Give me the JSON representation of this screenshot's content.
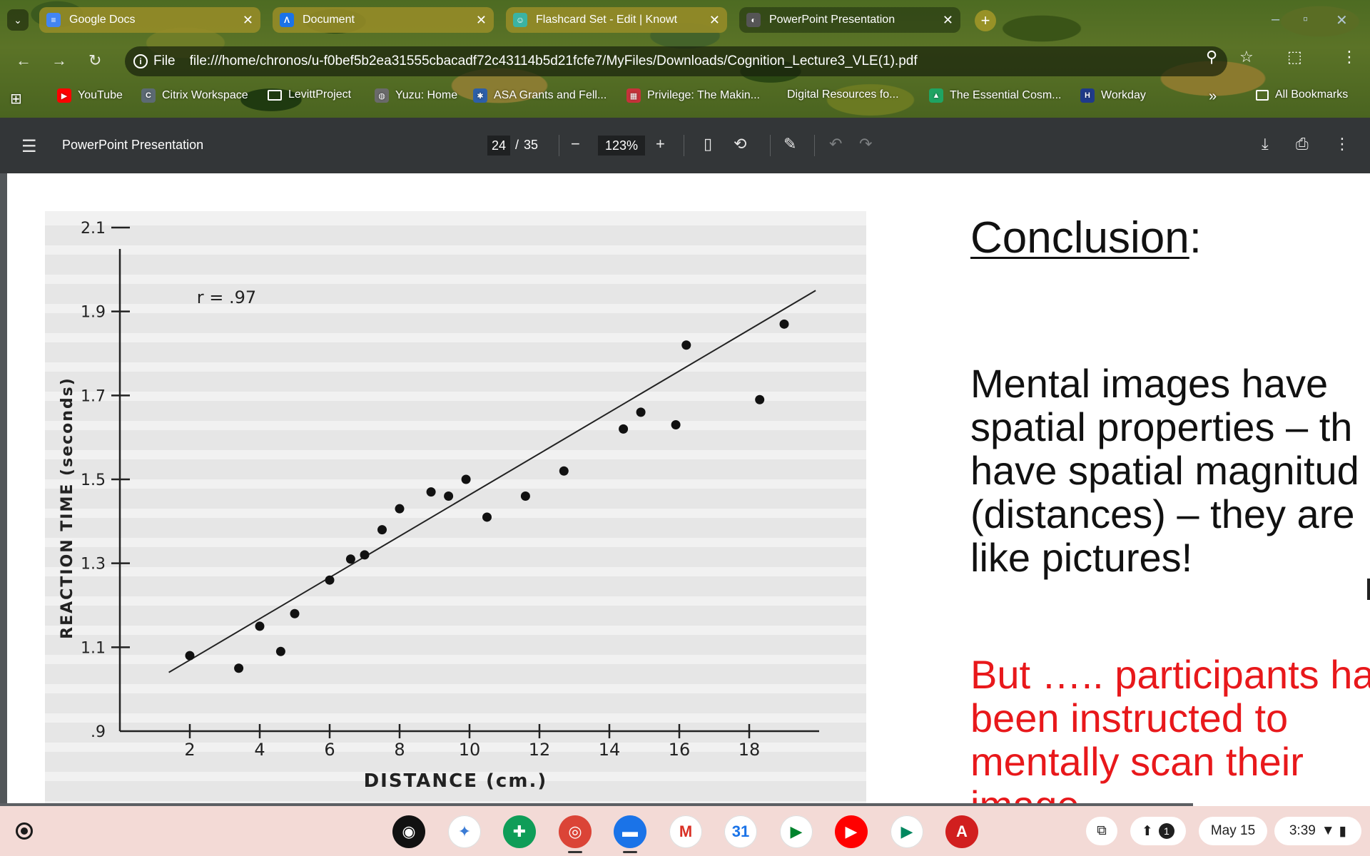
{
  "tabs": [
    {
      "title": "Google Docs",
      "icon": "docs-icon",
      "glyph": "≡",
      "color": "#4285f4",
      "active": false
    },
    {
      "title": "Document",
      "icon": "document-icon",
      "glyph": "Λ",
      "color": "#1a73e8",
      "active": false
    },
    {
      "title": "Flashcard Set - Edit | Knowt",
      "icon": "knowt-icon",
      "glyph": "☺",
      "color": "#3bb3a3",
      "active": false
    },
    {
      "title": "PowerPoint Presentation",
      "icon": "pdf-tab-icon",
      "glyph": "◐",
      "color": "#555555",
      "active": true
    }
  ],
  "omnibox": {
    "scheme": "File",
    "url": "file:///home/chronos/u-f0bef5b2ea31555cbacadf72c43114b5d21fcfe7/MyFiles/Downloads/Cognition_Lecture3_VLE(1).pdf"
  },
  "bookmarks": [
    {
      "label": "YouTube",
      "icon": "youtube-icon",
      "glyph": "▶",
      "color": "#ff0000"
    },
    {
      "label": "Citrix Workspace",
      "icon": "citrix-icon",
      "glyph": "C",
      "color": "#5c6a73"
    },
    {
      "label": "LevittProject",
      "icon": "folder-icon",
      "glyph": "",
      "color": "transparent"
    },
    {
      "label": "Yuzu: Home",
      "icon": "globe-icon",
      "glyph": "◍",
      "color": "#6a6a6a"
    },
    {
      "label": "ASA Grants and Fell...",
      "icon": "asa-icon",
      "glyph": "✱",
      "color": "#2d5fa8"
    },
    {
      "label": "Privilege: The Makin...",
      "icon": "book-icon",
      "glyph": "▦",
      "color": "#c7323a"
    },
    {
      "label": "Digital Resources fo...",
      "icon": "",
      "glyph": "",
      "color": "transparent"
    },
    {
      "label": "The Essential Cosm...",
      "icon": "drive-icon",
      "glyph": "▲",
      "color": "#1fa463"
    },
    {
      "label": "Workday",
      "icon": "workday-icon",
      "glyph": "H",
      "color": "#1f3a8a"
    }
  ],
  "bookmarks_more": "»",
  "all_bookmarks": "All Bookmarks",
  "pdf": {
    "title": "PowerPoint Presentation",
    "page_current": "24",
    "page_sep": "/",
    "page_total": "35",
    "zoom": "123%"
  },
  "chart_data": {
    "type": "scatter",
    "title": "",
    "annotation": "r = .97",
    "xlabel": "DISTANCE (cm.)",
    "ylabel": "REACTION TIME (seconds)",
    "xticks": [
      "2",
      "4",
      "6",
      "8",
      "10",
      "12",
      "14",
      "16",
      "18"
    ],
    "yticks": [
      ".9",
      "1.1",
      "1.3",
      "1.5",
      "1.7",
      "1.9",
      "2.1"
    ],
    "xlim": [
      0,
      20
    ],
    "ylim": [
      0.9,
      2.1
    ],
    "points": [
      [
        2.0,
        1.08
      ],
      [
        3.4,
        1.05
      ],
      [
        4.0,
        1.15
      ],
      [
        4.6,
        1.09
      ],
      [
        5.0,
        1.18
      ],
      [
        6.0,
        1.26
      ],
      [
        6.6,
        1.31
      ],
      [
        7.0,
        1.32
      ],
      [
        7.5,
        1.38
      ],
      [
        8.0,
        1.43
      ],
      [
        8.9,
        1.47
      ],
      [
        9.4,
        1.46
      ],
      [
        9.9,
        1.5
      ],
      [
        10.5,
        1.41
      ],
      [
        11.6,
        1.46
      ],
      [
        12.7,
        1.52
      ],
      [
        14.4,
        1.62
      ],
      [
        14.9,
        1.66
      ],
      [
        15.9,
        1.63
      ],
      [
        16.2,
        1.82
      ],
      [
        18.3,
        1.69
      ],
      [
        19.0,
        1.87
      ]
    ],
    "fit_line": [
      [
        1.4,
        1.04
      ],
      [
        19.9,
        1.95
      ]
    ],
    "grid": false,
    "legend": "none"
  },
  "slide": {
    "heading": "Conclusion",
    "heading_suffix": ":",
    "body_lines": [
      "Mental images have",
      "spatial properties – th",
      "have spatial magnitud",
      "(distances) – they are",
      "like pictures!"
    ],
    "red_lines": [
      "But ….. participants ha",
      "been instructed to",
      "mentally scan their",
      "image"
    ]
  },
  "shelf": {
    "apps": [
      {
        "name": "podcasts-app-icon",
        "glyph": "◉",
        "bg": "#111111"
      },
      {
        "name": "gemini-app-icon",
        "glyph": "✦",
        "bg": "#ffffff",
        "fg": "#3a7bd5"
      },
      {
        "name": "workspace-app-icon",
        "glyph": "✚",
        "bg": "#0f9d58"
      },
      {
        "name": "chrome-app-icon",
        "glyph": "◎",
        "bg": "#db4437",
        "dot": true
      },
      {
        "name": "files-app-icon",
        "glyph": "▬",
        "bg": "#1a73e8",
        "dot": true
      },
      {
        "name": "gmail-app-icon",
        "glyph": "M",
        "bg": "#ffffff",
        "fg": "#d93025"
      },
      {
        "name": "calendar-app-icon",
        "glyph": "31",
        "bg": "#ffffff",
        "fg": "#1a73e8"
      },
      {
        "name": "meet-app-icon",
        "glyph": "▶",
        "bg": "#ffffff",
        "fg": "#00832d"
      },
      {
        "name": "youtube-app-icon",
        "glyph": "▶",
        "bg": "#ff0000"
      },
      {
        "name": "play-store-app-icon",
        "glyph": "▶",
        "bg": "#ffffff",
        "fg": "#01875f"
      },
      {
        "name": "acrobat-app-icon",
        "glyph": "A",
        "bg": "#d11f1f"
      }
    ],
    "notification_count": "1",
    "date": "May 15",
    "time": "3:39"
  }
}
